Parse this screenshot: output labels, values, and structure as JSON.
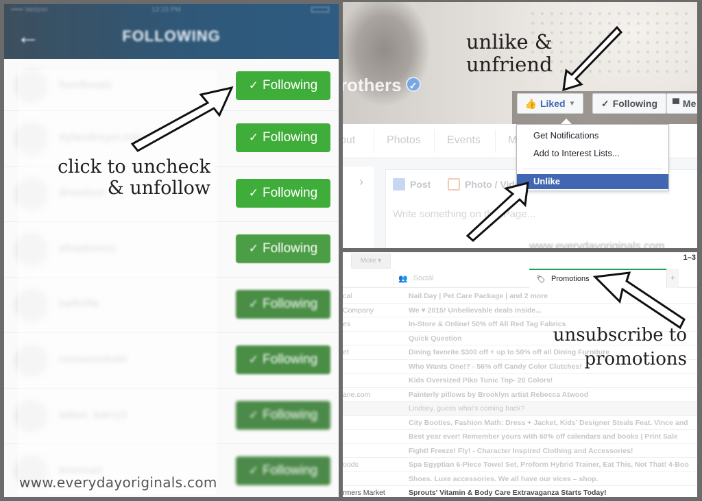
{
  "instagram": {
    "status_bar": {
      "carrier": "•••••  Verizon",
      "time": "12:15 PM"
    },
    "header": {
      "back_icon": "arrow-left-icon",
      "title": "FOLLOWING"
    },
    "rows": [
      {
        "username": "fionflorals",
        "button_label": "Following"
      },
      {
        "username": "dylandreyer.mbc",
        "button_label": "Following"
      },
      {
        "username": "dreadsst",
        "button_label": "Following"
      },
      {
        "username": "afsadowns",
        "button_label": "Following"
      },
      {
        "username": "heflriffe",
        "button_label": "Following"
      },
      {
        "username": "renewmrkebl",
        "button_label": "Following"
      },
      {
        "username": "adam_barry1",
        "button_label": "Following"
      },
      {
        "username": "brennan",
        "button_label": "Following"
      }
    ],
    "check_icon": "✓",
    "annotation": {
      "line1": "click to uncheck",
      "line2": "& unfollow"
    },
    "watermark": "www.everydayoriginals.com",
    "accent_color": "#3fad3a"
  },
  "facebook": {
    "page_name": "rothers",
    "verified_icon": "✓",
    "buttons": {
      "liked": "Liked",
      "following": "Following",
      "message": "Me"
    },
    "tabs": [
      "out",
      "Photos",
      "Events",
      "M"
    ],
    "composer": {
      "chevron": "›",
      "post_tab": "Post",
      "photo_tab": "Photo / Video",
      "placeholder": "Write something on this Page..."
    },
    "dropdown": {
      "items": [
        "Get Notifications",
        "Add to Interest Lists..."
      ],
      "selected": "Unlike"
    },
    "annotation": {
      "line1": "unlike &",
      "line2": "unfriend"
    },
    "watermark": "www.everydayoriginals.com",
    "accent_color": "#4267b2"
  },
  "gmail": {
    "more_button": "More ▾",
    "page_count": "1–3",
    "tabs": {
      "social": "Social",
      "promotions": "Promotions",
      "add": "+"
    },
    "rows": [
      {
        "sender": "cal",
        "subject": "Nail Day | Pet Care Package | and 2 more"
      },
      {
        "sender": "Company",
        "subject": "We ♥ 2015! Unbelievable deals inside..."
      },
      {
        "sender": "es",
        "subject": "In-Store & Online! 50% off All Red Tag Fabrics"
      },
      {
        "sender": "",
        "subject": "Quick Question"
      },
      {
        "sender": "et",
        "subject": "Dining favorite $300 off + up to 50% off all Dining Furniture"
      },
      {
        "sender": "",
        "subject": "Who Wants One!? - 56% off Candy Color Clutches!"
      },
      {
        "sender": "",
        "subject": "Kids Oversized Piko Tunic Top- 20 Colors!"
      },
      {
        "sender": "ane.com",
        "subject": "Painterly pillows by Brooklyn artist Rebecca Atwood"
      },
      {
        "sender": "",
        "subject": "Lindsey, guess what's coming back?"
      },
      {
        "sender": "",
        "subject": "City Booties, Fashion Math: Dress + Jacket, Kids' Designer Steals Feat. Vince and"
      },
      {
        "sender": "",
        "subject": "Best year ever! Remember yours with 60% off calendars and books | Print Sale"
      },
      {
        "sender": "",
        "subject": "Fight! Freeze! Fly! - Character Inspired Clothing and Accessories!"
      },
      {
        "sender": "oods",
        "subject": "Spa Egyptian 6-Piece Towel Set, Proform Hybrid Trainer, Eat This, Not That! 4-Boo"
      },
      {
        "sender": "",
        "subject": "Shoes. Luxe accessories. We all have our vices – shop."
      },
      {
        "sender": "rmers Market",
        "subject": "Sprouts' Vitamin & Body Care Extravaganza Starts Today!"
      }
    ],
    "annotation": {
      "line1": "unsubscribe to",
      "line2": "promotions"
    },
    "accent_color": "#1aa260"
  }
}
